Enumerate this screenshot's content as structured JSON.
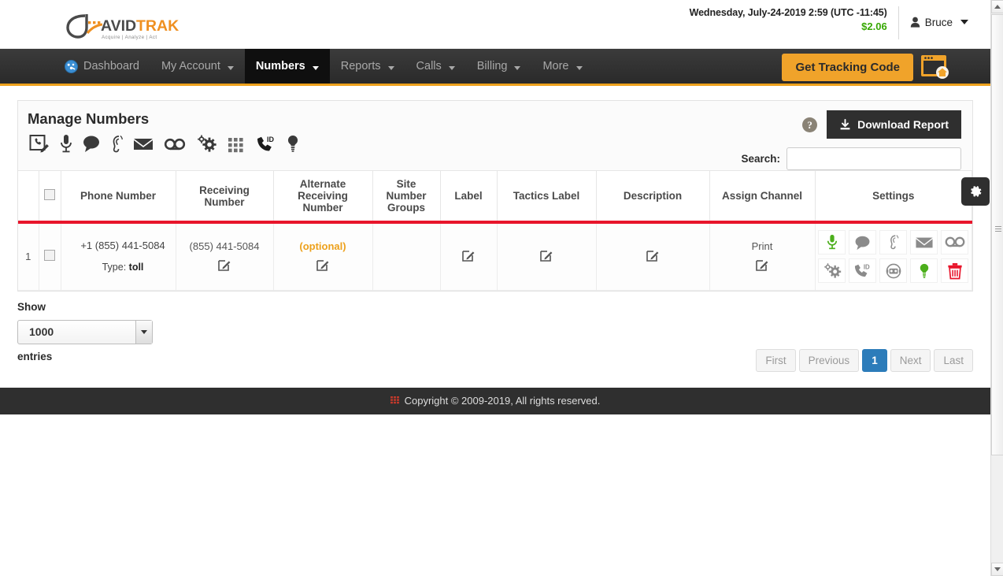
{
  "header": {
    "logo": {
      "name_dark": "AVID",
      "name_accent": "TRAK",
      "tagline": "Acquire  |  Analyze  |  Act"
    },
    "datetime": "Wednesday, July-24-2019 2:59 (UTC -11:45)",
    "balance": "$2.06",
    "balance_color": "#37a803",
    "user_name": "Bruce",
    "user_icon": "user-icon",
    "caret_icon": "caret-down-icon"
  },
  "nav": {
    "items": [
      {
        "label": "Dashboard",
        "icon": "speedometer-icon",
        "has_caret": false,
        "active": false
      },
      {
        "label": "My Account",
        "icon": "",
        "has_caret": true,
        "active": false
      },
      {
        "label": "Numbers",
        "icon": "",
        "has_caret": true,
        "active": true
      },
      {
        "label": "Reports",
        "icon": "",
        "has_caret": true,
        "active": false
      },
      {
        "label": "Calls",
        "icon": "",
        "has_caret": true,
        "active": false
      },
      {
        "label": "Billing",
        "icon": "",
        "has_caret": true,
        "active": false
      },
      {
        "label": "More",
        "icon": "",
        "has_caret": true,
        "active": false
      }
    ],
    "tracking_button": "Get Tracking Code",
    "tracking_button_color": "#f0a32a",
    "window_home_icon": "browser-window-home-icon"
  },
  "panel": {
    "title": "Manage Numbers",
    "help_icon": "help-circle-icon",
    "download_button": "Download Report",
    "download_icon": "download-icon",
    "gear_tab_icon": "gear-icon",
    "toolbar_icons": [
      "phone-edit-icon",
      "microphone-icon",
      "chat-bubble-icon",
      "ear-listen-icon",
      "envelope-icon",
      "voicemail-icon",
      "gears-icon",
      "keypad-grid-icon",
      "phone-caller-id-icon",
      "lightbulb-icon"
    ],
    "search": {
      "label": "Search:",
      "value": "",
      "placeholder": ""
    }
  },
  "table": {
    "columns": [
      "Phone Number",
      "Receiving Number",
      "Alternate Receiving Number",
      "Site Number Groups",
      "Label",
      "Tactics Label",
      "Description",
      "Assign Channel",
      "Settings"
    ],
    "header_select_all_icon": "checkbox-icon",
    "rows": [
      {
        "index": "1",
        "checkbox_icon": "checkbox-icon",
        "phone_number": "+1 (855) 441-5084",
        "type_label": "Type:",
        "type_value": "toll",
        "receiving_number": "(855) 441-5084",
        "alternate_receiving_number": "(optional)",
        "alternate_is_placeholder": true,
        "site_number_groups": "",
        "label": "",
        "tactics_label": "",
        "description": "",
        "assign_channel": "Print",
        "edit_icon": "edit-pencil-icon",
        "settings_icons": [
          {
            "name": "microphone-icon",
            "color": "#4caf1c"
          },
          {
            "name": "chat-bubble-icon",
            "color": "#8b8b8b"
          },
          {
            "name": "ear-listen-icon",
            "color": "#8b8b8b"
          },
          {
            "name": "envelope-icon",
            "color": "#8b8b8b"
          },
          {
            "name": "voicemail-icon",
            "color": "#8b8b8b"
          },
          {
            "name": "gears-icon",
            "color": "#8b8b8b"
          },
          {
            "name": "phone-caller-id-icon",
            "color": "#8b8b8b"
          },
          {
            "name": "headset-robot-icon",
            "color": "#8b8b8b"
          },
          {
            "name": "lightbulb-icon",
            "color": "#4caf1c"
          },
          {
            "name": "trash-delete-icon",
            "color": "#e8152b"
          }
        ]
      }
    ],
    "highlight_color": "#e8152b"
  },
  "controls": {
    "show_label": "Show",
    "entries_label": "entries",
    "page_size_value": "1000",
    "pagination": {
      "first": "First",
      "previous": "Previous",
      "current_page": "1",
      "next": "Next",
      "last": "Last",
      "current_color": "#2c7cba"
    }
  },
  "footer": {
    "icon": "grid-red-icon",
    "text": "Copyright © 2009-2019, All rights reserved."
  }
}
